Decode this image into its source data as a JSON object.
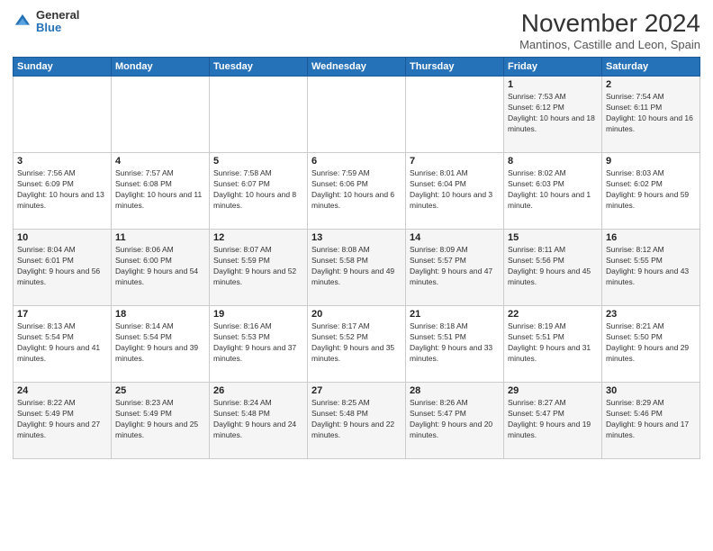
{
  "logo": {
    "general": "General",
    "blue": "Blue"
  },
  "header": {
    "month": "November 2024",
    "location": "Mantinos, Castille and Leon, Spain"
  },
  "weekdays": [
    "Sunday",
    "Monday",
    "Tuesday",
    "Wednesday",
    "Thursday",
    "Friday",
    "Saturday"
  ],
  "weeks": [
    [
      {
        "day": "",
        "info": ""
      },
      {
        "day": "",
        "info": ""
      },
      {
        "day": "",
        "info": ""
      },
      {
        "day": "",
        "info": ""
      },
      {
        "day": "",
        "info": ""
      },
      {
        "day": "1",
        "info": "Sunrise: 7:53 AM\nSunset: 6:12 PM\nDaylight: 10 hours and 18 minutes."
      },
      {
        "day": "2",
        "info": "Sunrise: 7:54 AM\nSunset: 6:11 PM\nDaylight: 10 hours and 16 minutes."
      }
    ],
    [
      {
        "day": "3",
        "info": "Sunrise: 7:56 AM\nSunset: 6:09 PM\nDaylight: 10 hours and 13 minutes."
      },
      {
        "day": "4",
        "info": "Sunrise: 7:57 AM\nSunset: 6:08 PM\nDaylight: 10 hours and 11 minutes."
      },
      {
        "day": "5",
        "info": "Sunrise: 7:58 AM\nSunset: 6:07 PM\nDaylight: 10 hours and 8 minutes."
      },
      {
        "day": "6",
        "info": "Sunrise: 7:59 AM\nSunset: 6:06 PM\nDaylight: 10 hours and 6 minutes."
      },
      {
        "day": "7",
        "info": "Sunrise: 8:01 AM\nSunset: 6:04 PM\nDaylight: 10 hours and 3 minutes."
      },
      {
        "day": "8",
        "info": "Sunrise: 8:02 AM\nSunset: 6:03 PM\nDaylight: 10 hours and 1 minute."
      },
      {
        "day": "9",
        "info": "Sunrise: 8:03 AM\nSunset: 6:02 PM\nDaylight: 9 hours and 59 minutes."
      }
    ],
    [
      {
        "day": "10",
        "info": "Sunrise: 8:04 AM\nSunset: 6:01 PM\nDaylight: 9 hours and 56 minutes."
      },
      {
        "day": "11",
        "info": "Sunrise: 8:06 AM\nSunset: 6:00 PM\nDaylight: 9 hours and 54 minutes."
      },
      {
        "day": "12",
        "info": "Sunrise: 8:07 AM\nSunset: 5:59 PM\nDaylight: 9 hours and 52 minutes."
      },
      {
        "day": "13",
        "info": "Sunrise: 8:08 AM\nSunset: 5:58 PM\nDaylight: 9 hours and 49 minutes."
      },
      {
        "day": "14",
        "info": "Sunrise: 8:09 AM\nSunset: 5:57 PM\nDaylight: 9 hours and 47 minutes."
      },
      {
        "day": "15",
        "info": "Sunrise: 8:11 AM\nSunset: 5:56 PM\nDaylight: 9 hours and 45 minutes."
      },
      {
        "day": "16",
        "info": "Sunrise: 8:12 AM\nSunset: 5:55 PM\nDaylight: 9 hours and 43 minutes."
      }
    ],
    [
      {
        "day": "17",
        "info": "Sunrise: 8:13 AM\nSunset: 5:54 PM\nDaylight: 9 hours and 41 minutes."
      },
      {
        "day": "18",
        "info": "Sunrise: 8:14 AM\nSunset: 5:54 PM\nDaylight: 9 hours and 39 minutes."
      },
      {
        "day": "19",
        "info": "Sunrise: 8:16 AM\nSunset: 5:53 PM\nDaylight: 9 hours and 37 minutes."
      },
      {
        "day": "20",
        "info": "Sunrise: 8:17 AM\nSunset: 5:52 PM\nDaylight: 9 hours and 35 minutes."
      },
      {
        "day": "21",
        "info": "Sunrise: 8:18 AM\nSunset: 5:51 PM\nDaylight: 9 hours and 33 minutes."
      },
      {
        "day": "22",
        "info": "Sunrise: 8:19 AM\nSunset: 5:51 PM\nDaylight: 9 hours and 31 minutes."
      },
      {
        "day": "23",
        "info": "Sunrise: 8:21 AM\nSunset: 5:50 PM\nDaylight: 9 hours and 29 minutes."
      }
    ],
    [
      {
        "day": "24",
        "info": "Sunrise: 8:22 AM\nSunset: 5:49 PM\nDaylight: 9 hours and 27 minutes."
      },
      {
        "day": "25",
        "info": "Sunrise: 8:23 AM\nSunset: 5:49 PM\nDaylight: 9 hours and 25 minutes."
      },
      {
        "day": "26",
        "info": "Sunrise: 8:24 AM\nSunset: 5:48 PM\nDaylight: 9 hours and 24 minutes."
      },
      {
        "day": "27",
        "info": "Sunrise: 8:25 AM\nSunset: 5:48 PM\nDaylight: 9 hours and 22 minutes."
      },
      {
        "day": "28",
        "info": "Sunrise: 8:26 AM\nSunset: 5:47 PM\nDaylight: 9 hours and 20 minutes."
      },
      {
        "day": "29",
        "info": "Sunrise: 8:27 AM\nSunset: 5:47 PM\nDaylight: 9 hours and 19 minutes."
      },
      {
        "day": "30",
        "info": "Sunrise: 8:29 AM\nSunset: 5:46 PM\nDaylight: 9 hours and 17 minutes."
      }
    ]
  ]
}
